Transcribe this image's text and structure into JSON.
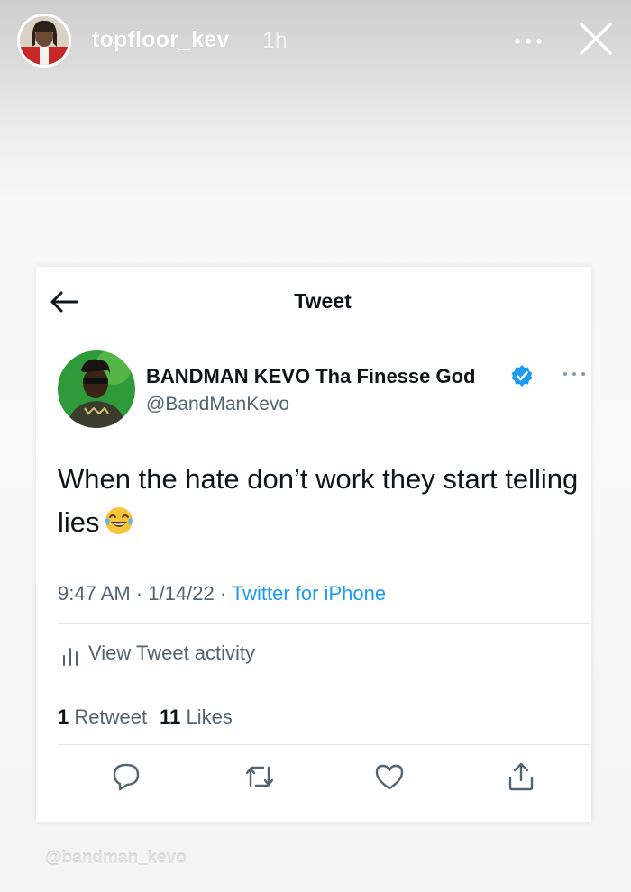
{
  "story": {
    "username": "topfloor_kev",
    "time": "1h",
    "more_icon": "more-horizontal-icon",
    "close_icon": "close-icon"
  },
  "tweet_card": {
    "nav_title": "Tweet",
    "back_icon": "back-arrow-icon",
    "author": {
      "display_name": "BANDMAN KEVO Tha Finesse God",
      "handle": "@BandManKevo",
      "verified": true
    },
    "text": "When the hate don’t work they start telling lies",
    "emoji": "face-with-tears-of-joy",
    "meta": {
      "time": "9:47 AM",
      "date": "1/14/22",
      "separator": "·",
      "source": "Twitter for iPhone"
    },
    "activity_label": "View Tweet activity",
    "stats": {
      "retweets_count": "1",
      "retweets_label": "Retweet",
      "likes_count": "11",
      "likes_label": "Likes"
    },
    "actions": [
      "reply-icon",
      "retweet-icon",
      "like-icon",
      "share-icon"
    ]
  },
  "watermark": "@bandman_kevo",
  "colors": {
    "text_primary": "#0f1419",
    "text_secondary": "#536471",
    "link_blue": "#1d9bf0",
    "verified_blue": "#1d9bf0"
  }
}
